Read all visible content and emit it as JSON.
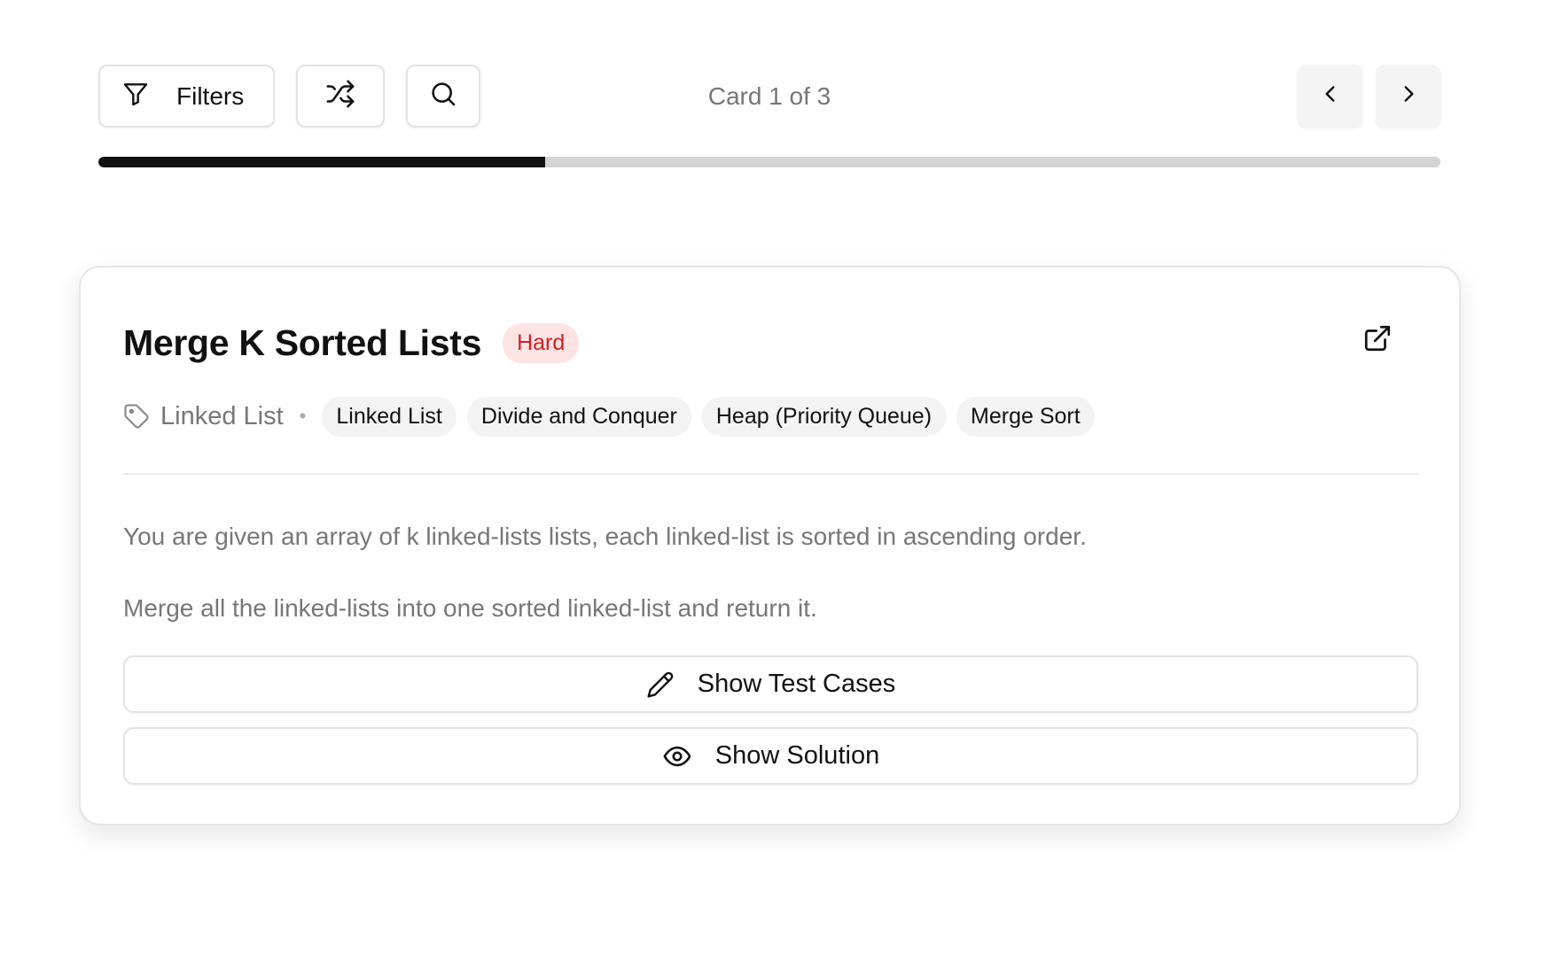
{
  "toolbar": {
    "filters_label": "Filters",
    "counter_text": "Card 1 of 3"
  },
  "progress": {
    "fraction": 0.333
  },
  "card": {
    "title": "Merge K Sorted Lists",
    "difficulty": "Hard",
    "category": "Linked List",
    "tags": [
      "Linked List",
      "Divide and Conquer",
      "Heap (Priority Queue)",
      "Merge Sort"
    ],
    "description": [
      "You are given an array of k linked-lists lists, each linked-list is sorted in ascending order.",
      "Merge all the linked-lists into one sorted linked-list and return it."
    ],
    "show_test_cases_label": "Show Test Cases",
    "show_solution_label": "Show Solution"
  },
  "icons": {
    "filter": "filter-icon",
    "shuffle": "shuffle-icon",
    "search": "search-icon",
    "prev": "chevron-left-icon",
    "next": "chevron-right-icon",
    "external": "external-link-icon",
    "tag": "tag-icon",
    "pencil": "pencil-icon",
    "eye": "eye-icon"
  },
  "colors": {
    "accent": "#111111",
    "hard_badge_bg": "#fde3e3",
    "hard_badge_text": "#d11f1f"
  }
}
